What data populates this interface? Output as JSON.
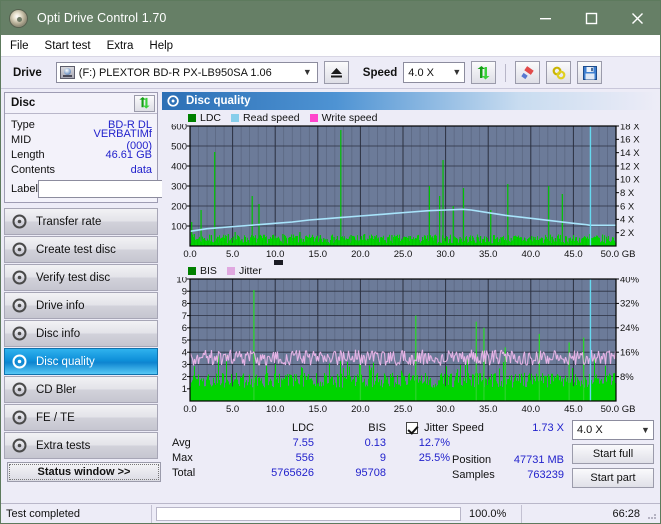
{
  "window": {
    "title": "Opti Drive Control 1.70",
    "icon": "disc-icon",
    "minimize": "minimize-icon",
    "maximize": "maximize-icon",
    "close": "close-icon"
  },
  "menu": [
    {
      "label": "File",
      "accel": "F"
    },
    {
      "label": "Start test",
      "accel": "S"
    },
    {
      "label": "Extra",
      "accel": "x"
    },
    {
      "label": "Help",
      "accel": "H"
    }
  ],
  "toolbar": {
    "drive_label": "Drive",
    "drive_value": "(F:)  PLEXTOR BD-R  PX-LB950SA 1.06",
    "eject_icon": "eject-icon",
    "speed_label": "Speed",
    "speed_value": "4.0 X",
    "refresh_icon": "refresh-icon",
    "eraser_icon": "eraser-icon",
    "link_icon": "link-icon",
    "save_icon": "save-icon"
  },
  "disc": {
    "title": "Disc",
    "refresh_icon": "refresh-icon",
    "rows": [
      {
        "key": "Type",
        "value": "BD-R DL"
      },
      {
        "key": "MID",
        "value": "VERBATIMf (000)"
      },
      {
        "key": "Length",
        "value": "46.61 GB"
      },
      {
        "key": "Contents",
        "value": "data"
      }
    ],
    "label_key": "Label",
    "label_value": "",
    "label_placeholder": "",
    "label_icon": "cd-icon"
  },
  "nav": {
    "items": [
      {
        "label": "Transfer rate",
        "selected": false
      },
      {
        "label": "Create test disc",
        "selected": false
      },
      {
        "label": "Verify test disc",
        "selected": false
      },
      {
        "label": "Drive info",
        "selected": false
      },
      {
        "label": "Disc info",
        "selected": false
      },
      {
        "label": "Disc quality",
        "selected": true
      },
      {
        "label": "CD Bler",
        "selected": false
      },
      {
        "label": "FE / TE",
        "selected": false
      },
      {
        "label": "Extra tests",
        "selected": false
      }
    ]
  },
  "status_window_button": "Status window >>",
  "panel": {
    "title": "Disc quality",
    "icon": "disc-quality-icon"
  },
  "chart_data": [
    {
      "type": "bar",
      "name": "top-chart",
      "title": "",
      "xlabel": "GB",
      "ylabel": "",
      "xlim": [
        0,
        50
      ],
      "ylim": [
        0,
        600
      ],
      "y2lim": [
        0,
        18
      ],
      "y2label": "X",
      "grid": true,
      "legend": [
        {
          "label": "LDC",
          "color": "#008000"
        },
        {
          "label": "Read speed",
          "color": "#87ceeb"
        },
        {
          "label": "Write speed",
          "color": "#ff44cc"
        }
      ],
      "xticks": [
        "0.0",
        "5.0",
        "10.0",
        "15.0",
        "20.0",
        "25.0",
        "30.0",
        "35.0",
        "40.0",
        "45.0",
        "50.0"
      ],
      "yticks": [
        "600",
        "500",
        "400",
        "300",
        "200",
        "100"
      ],
      "y2ticks": [
        "18 X",
        "16 X",
        "14 X",
        "12 X",
        "10 X",
        "8 X",
        "6 X",
        "4 X",
        "2 X"
      ],
      "x_unit": "GB",
      "series": [
        {
          "name": "LDC",
          "color": "#00c800",
          "x": [
            0.2,
            0.5,
            0.9,
            1.3,
            1.7,
            2.1,
            2.5,
            2.9,
            3.3,
            3.7,
            4.1,
            4.5,
            4.9,
            5.3,
            5.7,
            6.1,
            6.5,
            6.9,
            7.3,
            7.7,
            8.1,
            8.5,
            8.9,
            9.3,
            9.7,
            10.1,
            10.5,
            10.9,
            11.3,
            11.7,
            12.1,
            12.5,
            12.9,
            13.3,
            13.7,
            14.1,
            14.5,
            14.9,
            15.3,
            15.7,
            16.1,
            16.5,
            16.9,
            17.3,
            17.7,
            18.1,
            18.5,
            18.9,
            19.3,
            19.7,
            20.1,
            20.5,
            20.9,
            21.3,
            21.7,
            22.1,
            22.5,
            22.9,
            23.3,
            23.7,
            24.1,
            24.5,
            24.9,
            25.3,
            25.7,
            26.1,
            26.5,
            26.9,
            27.3,
            27.7,
            28.1,
            28.5,
            28.9,
            29.3,
            29.7,
            30.1,
            30.5,
            30.9,
            31.3,
            31.7,
            32.1,
            32.5,
            32.9,
            33.3,
            33.7,
            34.1,
            34.5,
            34.9,
            35.3,
            35.7,
            36.1,
            36.5,
            36.9,
            37.3,
            37.7,
            38.1,
            38.5,
            38.9,
            39.3,
            39.7,
            40.1,
            40.5,
            40.9,
            41.3,
            41.7,
            42.1,
            42.5,
            42.9,
            43.3,
            43.7,
            44.1,
            44.5,
            44.9,
            45.3,
            45.7,
            46.1,
            46.5,
            46.9
          ],
          "values": [
            120,
            60,
            35,
            180,
            40,
            30,
            55,
            470,
            45,
            25,
            35,
            60,
            40,
            70,
            50,
            35,
            45,
            30,
            250,
            40,
            210,
            30,
            45,
            35,
            55,
            40,
            30,
            60,
            35,
            45,
            40,
            50,
            70,
            35,
            30,
            40,
            45,
            35,
            55,
            40,
            35,
            30,
            45,
            50,
            580,
            40,
            35,
            55,
            40,
            30,
            45,
            60,
            35,
            40,
            50,
            35,
            45,
            30,
            40,
            55,
            35,
            40,
            30,
            45,
            50,
            35,
            40,
            30,
            45,
            35,
            300,
            40,
            35,
            250,
            430,
            50,
            35,
            200,
            40,
            45,
            290,
            35,
            40,
            30,
            45,
            50,
            35,
            40,
            180,
            35,
            40,
            45,
            30,
            310,
            40,
            35,
            45,
            30,
            40,
            35,
            50,
            45,
            30,
            40,
            35,
            300,
            45,
            40,
            35,
            260,
            50,
            40,
            35,
            45,
            30,
            40,
            35,
            60
          ]
        },
        {
          "name": "Read speed",
          "color": "#9fdcf6",
          "x": [
            0,
            2,
            4,
            6,
            8,
            10,
            12,
            14,
            16,
            18,
            20,
            22,
            24,
            26,
            28,
            30,
            32,
            33,
            35,
            37,
            39,
            41,
            43,
            45,
            46.5,
            47,
            50
          ],
          "values": [
            2.2,
            2.6,
            2.8,
            3.0,
            3.2,
            3.4,
            3.6,
            3.9,
            4.1,
            4.3,
            4.5,
            4.7,
            4.9,
            5.1,
            5.3,
            5.4,
            5.5,
            5.4,
            5.0,
            4.6,
            4.3,
            4.0,
            3.7,
            3.4,
            3.2,
            3.1,
            3.1
          ]
        }
      ],
      "cursor_x": 47.0,
      "cursor_color": "#66d9ef"
    },
    {
      "type": "bar",
      "name": "bottom-chart",
      "title": "",
      "xlabel": "GB",
      "ylabel": "",
      "xlim": [
        0,
        50
      ],
      "ylim": [
        0,
        10
      ],
      "y2lim": [
        0,
        40
      ],
      "y2label": "%",
      "grid": true,
      "legend": [
        {
          "label": "BIS",
          "color": "#008000"
        },
        {
          "label": "Jitter",
          "color": "#e0a8e0"
        }
      ],
      "xticks": [
        "0.0",
        "5.0",
        "10.0",
        "15.0",
        "20.0",
        "25.0",
        "30.0",
        "35.0",
        "40.0",
        "45.0",
        "50.0"
      ],
      "yticks": [
        "10",
        "9",
        "8",
        "7",
        "6",
        "5",
        "4",
        "3",
        "2",
        "1"
      ],
      "y2ticks": [
        "40%",
        "32%",
        "24%",
        "16%",
        "8%"
      ],
      "x_unit": "GB",
      "series": [
        {
          "name": "BIS",
          "color": "#00c800",
          "baseline": 2.0,
          "peaks": [
            {
              "x": 7.5,
              "y": 9.1
            },
            {
              "x": 26.5,
              "y": 7.0
            },
            {
              "x": 33.6,
              "y": 6.5
            },
            {
              "x": 34.5,
              "y": 6.0
            },
            {
              "x": 41.0,
              "y": 5.5
            },
            {
              "x": 44.5,
              "y": 4.8
            },
            {
              "x": 46.2,
              "y": 5.2
            },
            {
              "x": 37.0,
              "y": 4.4
            },
            {
              "x": 20.0,
              "y": 3.4
            }
          ]
        },
        {
          "name": "Jitter",
          "color": "#e6b3e6",
          "avg": 3.4,
          "band_low": 2.9,
          "band_high": 4.2
        }
      ],
      "cursor_x": 47.0,
      "cursor_color": "#66d9ef"
    }
  ],
  "stats": {
    "headers": [
      "",
      "LDC",
      "BIS",
      "Jitter"
    ],
    "jitter_checked": true,
    "rows": [
      {
        "label": "Avg",
        "ldc": "7.55",
        "bis": "0.13",
        "jitter": "12.7%"
      },
      {
        "label": "Max",
        "ldc": "556",
        "bis": "9",
        "jitter": "25.5%"
      },
      {
        "label": "Total",
        "ldc": "5765626",
        "bis": "95708",
        "jitter": ""
      }
    ]
  },
  "readout": {
    "speed_label": "Speed",
    "speed_value": "1.73 X",
    "position_label": "Position",
    "position_value": "47731 MB",
    "samples_label": "Samples",
    "samples_value": "763239",
    "speed_select": "4.0 X",
    "start_full": "Start full",
    "start_part": "Start part"
  },
  "statusbar": {
    "message": "Test completed",
    "progress_percent": 100.0,
    "progress_text": "100.0%",
    "elapsed": "66:28",
    "progress_color": "#07b807"
  }
}
